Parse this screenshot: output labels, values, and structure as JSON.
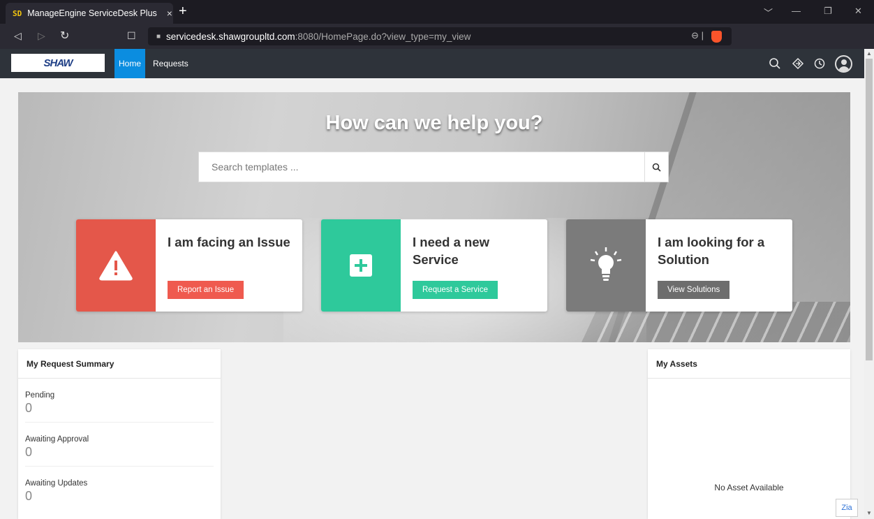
{
  "browser": {
    "tab_title": "ManageEngine ServiceDesk Plus",
    "favicon": "SD",
    "tab_close": "×",
    "new_tab": "+",
    "url_host": "servicedesk.shawgroupltd.com",
    "url_rest": ":8080/HomePage.do?view_type=my_view"
  },
  "header": {
    "logo_text": "SHAW",
    "nav": {
      "home": "Home",
      "requests": "Requests"
    }
  },
  "hero": {
    "title": "How can we help you?",
    "search_placeholder": "Search templates ..."
  },
  "cards": [
    {
      "title": "I am facing an Issue",
      "button": "Report an Issue",
      "color": "#e4574a",
      "button_color": "#ef5a4f",
      "icon": "warning-icon"
    },
    {
      "title": "I need a new Service",
      "button": "Request a Service",
      "color": "#2ec99b",
      "button_color": "#2ec99b",
      "icon": "plus-icon"
    },
    {
      "title": "I am looking for a Solution",
      "button": "View Solutions",
      "color": "#7b7b7b",
      "button_color": "#6d6d6d",
      "icon": "lightbulb-icon"
    }
  ],
  "summary": {
    "title": "My Request Summary",
    "rows": [
      {
        "label": "Pending",
        "value": "0"
      },
      {
        "label": "Awaiting Approval",
        "value": "0"
      },
      {
        "label": "Awaiting Updates",
        "value": "0"
      }
    ]
  },
  "assets": {
    "title": "My Assets",
    "empty_text": "No Asset Available"
  },
  "zia": "Zia"
}
